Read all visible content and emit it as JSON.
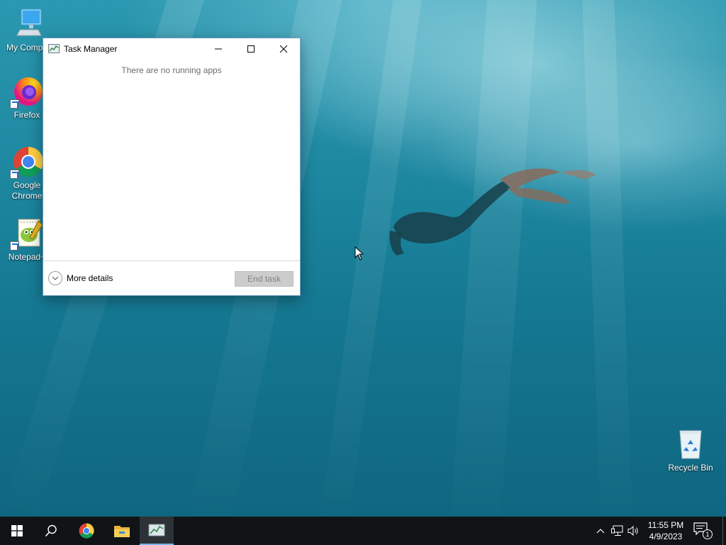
{
  "desktop": {
    "icons": [
      {
        "label": "My Compu",
        "icon": "computer-icon"
      },
      {
        "label": "Firefox",
        "icon": "firefox-icon"
      },
      {
        "label": "Google Chrome",
        "icon": "chrome-icon"
      },
      {
        "label": "Notepad+",
        "icon": "notepad-plus-plus-icon"
      },
      {
        "label": "Recycle Bin",
        "icon": "recycle-bin-icon"
      }
    ]
  },
  "task_manager": {
    "title": "Task Manager",
    "empty_message": "There are no running apps",
    "more_details_label": "More details",
    "end_task_label": "End task",
    "end_task_enabled": false
  },
  "taskbar": {
    "buttons": [
      {
        "name": "start",
        "icon": "windows-logo-icon"
      },
      {
        "name": "search",
        "icon": "search-icon"
      },
      {
        "name": "chrome",
        "icon": "chrome-icon"
      },
      {
        "name": "file-explorer",
        "icon": "folder-icon"
      },
      {
        "name": "task-manager",
        "icon": "task-manager-icon",
        "active": true
      }
    ],
    "tray": {
      "time": "11:55 PM",
      "date": "4/9/2023",
      "notification_count": "1"
    }
  },
  "colors": {
    "taskbar": "#101416",
    "active_indicator": "#76b9ed",
    "water": "#1d87a0"
  }
}
